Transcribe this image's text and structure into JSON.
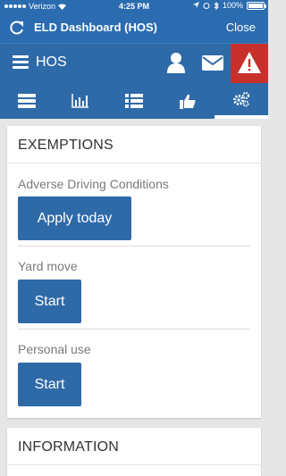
{
  "status_bar": {
    "carrier": "Verizon",
    "time": "4:25 PM",
    "battery": "100%"
  },
  "title_bar": {
    "title": "ELD Dashboard (HOS)",
    "close_label": "Close"
  },
  "app_bar": {
    "label": "HOS"
  },
  "tabs": [
    {
      "icon": "list-icon",
      "active": false
    },
    {
      "icon": "bar-chart-icon",
      "active": false
    },
    {
      "icon": "bulleted-list-icon",
      "active": false
    },
    {
      "icon": "thumbs-up-icon",
      "active": false
    },
    {
      "icon": "gears-icon",
      "active": true
    }
  ],
  "exemptions": {
    "title": "EXEMPTIONS",
    "items": [
      {
        "label": "Adverse Driving Conditions",
        "button": "Apply today"
      },
      {
        "label": "Yard move",
        "button": "Start"
      },
      {
        "label": "Personal use",
        "button": "Start"
      }
    ]
  },
  "information": {
    "title": "INFORMATION"
  },
  "colors": {
    "primary": "#2f6aa8",
    "alert": "#c8302b"
  }
}
